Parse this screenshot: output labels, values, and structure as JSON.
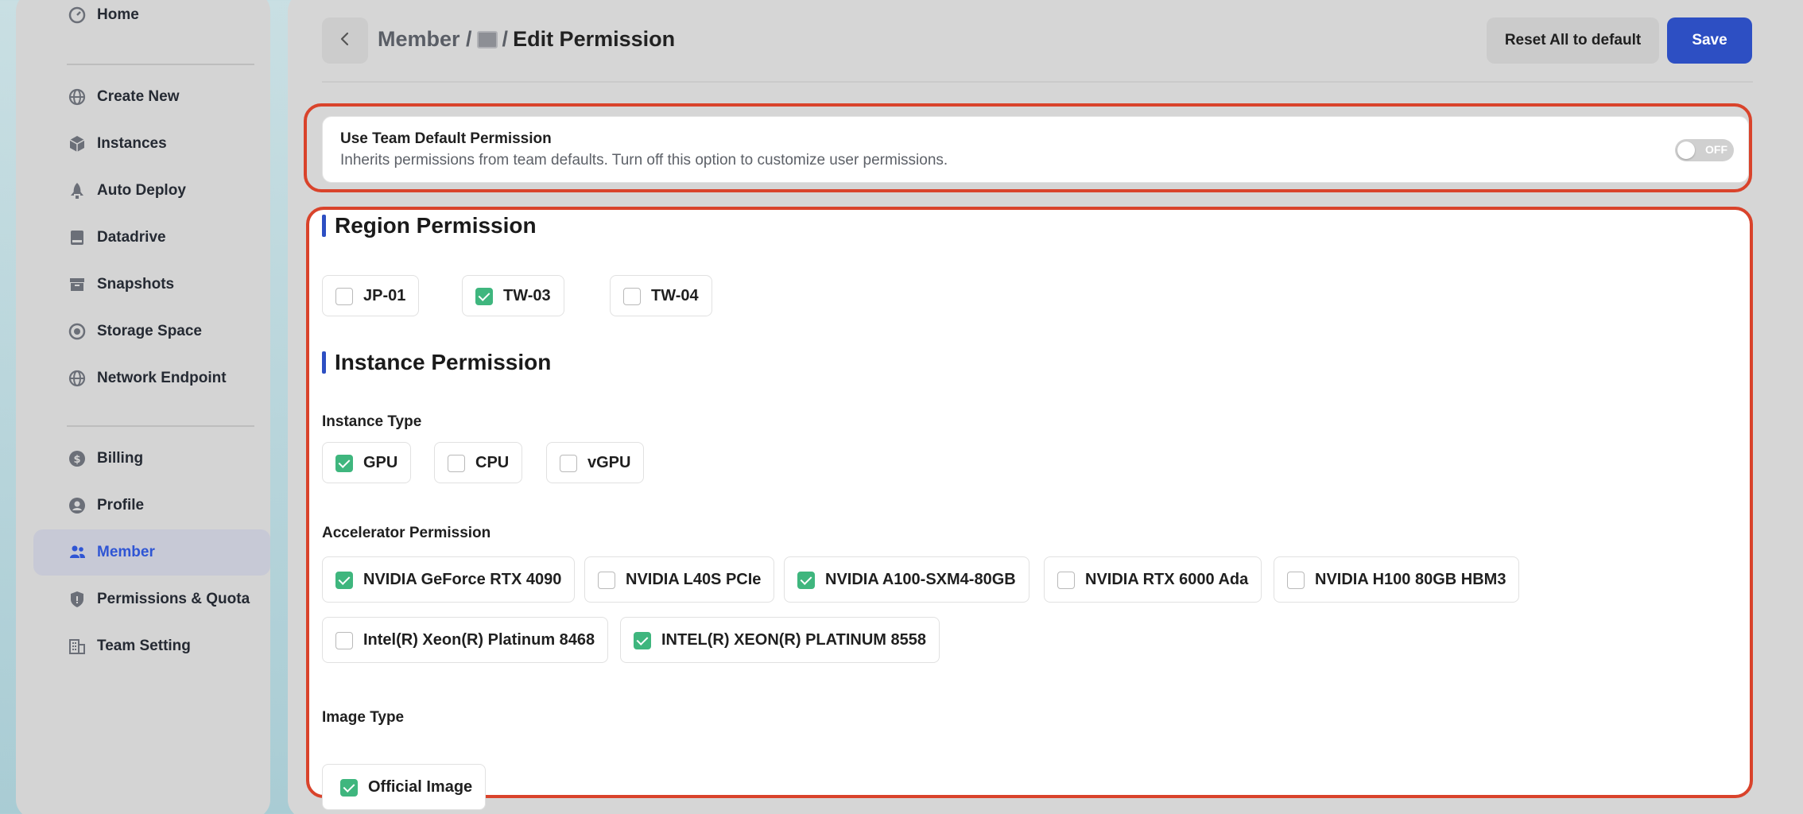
{
  "sidebar": {
    "items": [
      {
        "label": "Home",
        "icon": "gauge-icon",
        "active": false
      },
      {
        "label": "Create New",
        "icon": "globe-icon",
        "active": false
      },
      {
        "label": "Instances",
        "icon": "cube-icon",
        "active": false
      },
      {
        "label": "Auto Deploy",
        "icon": "rocket-icon",
        "active": false
      },
      {
        "label": "Datadrive",
        "icon": "drive-icon",
        "active": false
      },
      {
        "label": "Snapshots",
        "icon": "archive-icon",
        "active": false
      },
      {
        "label": "Storage Space",
        "icon": "storage-icon",
        "active": false
      },
      {
        "label": "Network Endpoint",
        "icon": "network-icon",
        "active": false
      },
      {
        "label": "Billing",
        "icon": "dollar-icon",
        "active": false
      },
      {
        "label": "Profile",
        "icon": "user-icon",
        "active": false
      },
      {
        "label": "Member",
        "icon": "users-icon",
        "active": true
      },
      {
        "label": "Permissions & Quota",
        "icon": "shield-icon",
        "active": false
      },
      {
        "label": "Team Setting",
        "icon": "building-icon",
        "active": false
      }
    ]
  },
  "header": {
    "breadcrumb_parent": "Member /",
    "breadcrumb_sep": "/",
    "title": "Edit Permission",
    "reset_label": "Reset All to default",
    "save_label": "Save"
  },
  "default_permission": {
    "title": "Use Team Default Permission",
    "description": "Inherits permissions from team defaults. Turn off this option to customize user permissions.",
    "toggle_label": "OFF",
    "enabled": false
  },
  "region_permission": {
    "heading": "Region Permission",
    "options": [
      {
        "label": "JP-01",
        "checked": false
      },
      {
        "label": "TW-03",
        "checked": true
      },
      {
        "label": "TW-04",
        "checked": false
      }
    ]
  },
  "instance_permission": {
    "heading": "Instance Permission",
    "instance_type": {
      "label": "Instance Type",
      "options": [
        {
          "label": "GPU",
          "checked": true
        },
        {
          "label": "CPU",
          "checked": false
        },
        {
          "label": "vGPU",
          "checked": false
        }
      ]
    },
    "accelerator": {
      "label": "Accelerator Permission",
      "options": [
        {
          "label": "NVIDIA GeForce RTX 4090",
          "checked": true
        },
        {
          "label": "NVIDIA L40S PCIe",
          "checked": false
        },
        {
          "label": "NVIDIA A100-SXM4-80GB",
          "checked": true
        },
        {
          "label": "NVIDIA RTX 6000 Ada",
          "checked": false
        },
        {
          "label": "NVIDIA H100 80GB HBM3",
          "checked": false
        },
        {
          "label": "Intel(R) Xeon(R) Platinum 8468",
          "checked": false
        },
        {
          "label": "INTEL(R) XEON(R) PLATINUM 8558",
          "checked": true
        }
      ]
    },
    "image_type": {
      "label": "Image Type",
      "options": [
        {
          "label": "Official Image",
          "checked": true
        }
      ]
    }
  },
  "colors": {
    "accent": "#2d4fc3",
    "check_green": "#3fb67e",
    "highlight_red": "#d9432b"
  }
}
